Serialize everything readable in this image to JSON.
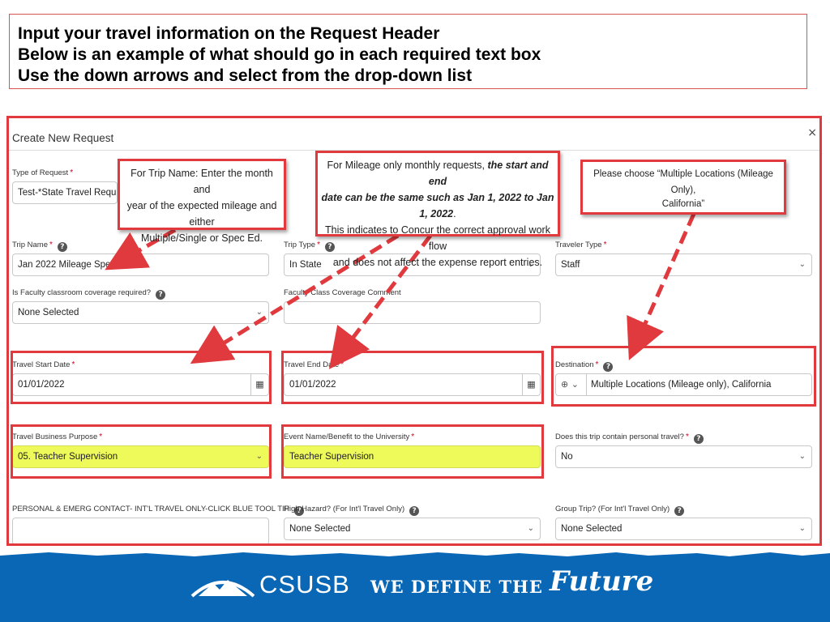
{
  "slide": {
    "lines": [
      "Input your travel information on the Request Header",
      "Below is an example of what should go in each required text box",
      "Use the down arrows and select from the drop-down list"
    ]
  },
  "modal": {
    "title": "Create New Request",
    "close": "×"
  },
  "fields": {
    "type_of_request": {
      "label": "Type of Request",
      "value": "Test-*State Travel Request Po"
    },
    "trip_name": {
      "label": "Trip Name",
      "value": "Jan 2022 Mileage Special Ed"
    },
    "trip_type": {
      "label": "Trip Type",
      "value": "In State"
    },
    "traveler_type": {
      "label": "Traveler Type",
      "value": "Staff"
    },
    "faculty_coverage": {
      "label": "Is Faculty classroom coverage required?",
      "value": "None Selected"
    },
    "faculty_comment": {
      "label": "Faculty Class Coverage Comment",
      "value": ""
    },
    "start_date": {
      "label": "Travel Start Date",
      "value": "01/01/2022"
    },
    "end_date": {
      "label": "Travel End Date",
      "value": "01/01/2022"
    },
    "destination": {
      "label": "Destination",
      "value": "Multiple Locations (Mileage only), California"
    },
    "business_purpose": {
      "label": "Travel Business Purpose",
      "value": "05. Teacher Supervision"
    },
    "event_name": {
      "label": "Event Name/Benefit to the University",
      "value": "Teacher Supervision"
    },
    "personal_travel": {
      "label": "Does this trip contain personal travel?",
      "value": "No"
    },
    "emerg_contact": {
      "label": "PERSONAL & EMERG CONTACT- INT'L TRAVEL ONLY-CLICK BLUE TOOL TIP",
      "value": ""
    },
    "high_hazard": {
      "label": "High Hazard? (For Int'l Travel Only)",
      "value": "None Selected"
    },
    "group_trip": {
      "label": "Group Trip? (For Int'l Travel Only)",
      "value": "None Selected"
    }
  },
  "callouts": {
    "trip_name": {
      "lines": [
        "For Trip Name: Enter the month and",
        "year of the expected mileage and either",
        "Multiple/Single or Spec Ed."
      ]
    },
    "mileage": {
      "line1_a": "For Mileage only monthly requests, ",
      "line1_b": "the start and end",
      "line2_a": "date can be the same such as Jan 1, 2022 to Jan 1, 2022",
      "line2_b": ".",
      "line3": "This indicates to Concur the correct approval work flow",
      "line4": "and does not affect the expense report entries."
    },
    "destination": {
      "lines": [
        "Please choose  “Multiple Locations (Mileage Only),",
        "California”"
      ]
    }
  },
  "footer": {
    "brand": "CSUSB",
    "tagline": "WE DEFINE THE",
    "tagline_script": "Future"
  },
  "colors": {
    "highlight_red": "#e03a3e",
    "field_yellow": "#eef95a",
    "footer_blue": "#0a67b5"
  }
}
